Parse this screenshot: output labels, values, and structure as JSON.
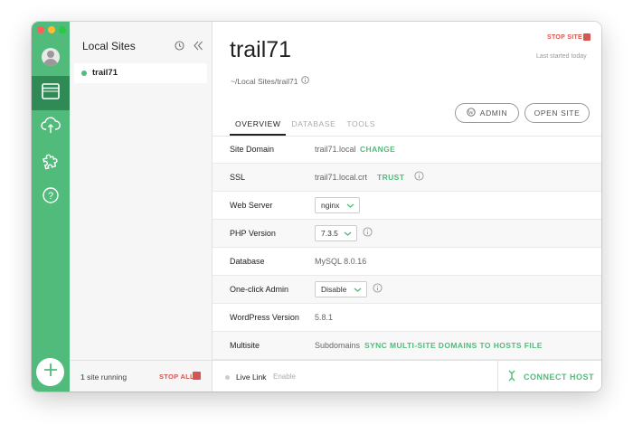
{
  "sidebar_rail": {
    "items": [
      {
        "name": "sites",
        "icon": "browser-window-icon",
        "active": true
      },
      {
        "name": "connect",
        "icon": "cloud-sync-icon",
        "active": false
      },
      {
        "name": "addons",
        "icon": "puzzle-icon",
        "active": false
      },
      {
        "name": "help",
        "icon": "question-circle-icon",
        "active": false
      }
    ],
    "add_icon": "plus-icon"
  },
  "sites_panel": {
    "title": "Local Sites",
    "sites": [
      {
        "name": "trail71",
        "status": "running"
      }
    ],
    "footer": {
      "running_count": "1",
      "running_text": "site running",
      "stop_all_label": "STOP ALL"
    }
  },
  "site": {
    "title": "trail71",
    "path": "~/Local Sites/trail71",
    "stop_site_label": "STOP SITE",
    "last_started": "Last started today",
    "tabs": [
      {
        "label": "OVERVIEW",
        "active": true
      },
      {
        "label": "DATABASE",
        "active": false
      },
      {
        "label": "TOOLS",
        "active": false
      }
    ],
    "admin_label": "ADMIN",
    "open_site_label": "OPEN SITE",
    "overview": {
      "site_domain": {
        "label": "Site Domain",
        "value": "trail71.local",
        "action": "CHANGE"
      },
      "ssl": {
        "label": "SSL",
        "value": "trail71.local.crt",
        "action": "TRUST"
      },
      "web_server": {
        "label": "Web Server",
        "value": "nginx"
      },
      "php_version": {
        "label": "PHP Version",
        "value": "7.3.5"
      },
      "database": {
        "label": "Database",
        "value": "MySQL 8.0.16"
      },
      "one_click_admin": {
        "label": "One-click Admin",
        "value": "Disable"
      },
      "wordpress_version": {
        "label": "WordPress Version",
        "value": "5.8.1"
      },
      "multisite": {
        "label": "Multisite",
        "value": "Subdomains",
        "action": "SYNC MULTI-SITE DOMAINS TO HOSTS FILE"
      }
    }
  },
  "footer": {
    "live_link_label": "Live Link",
    "live_link_action": "Enable",
    "connect_host_label": "CONNECT HOST"
  },
  "colors": {
    "accent_green": "#51bb7b",
    "dark_green": "#2f8a55",
    "stop_red": "#d9544f"
  }
}
